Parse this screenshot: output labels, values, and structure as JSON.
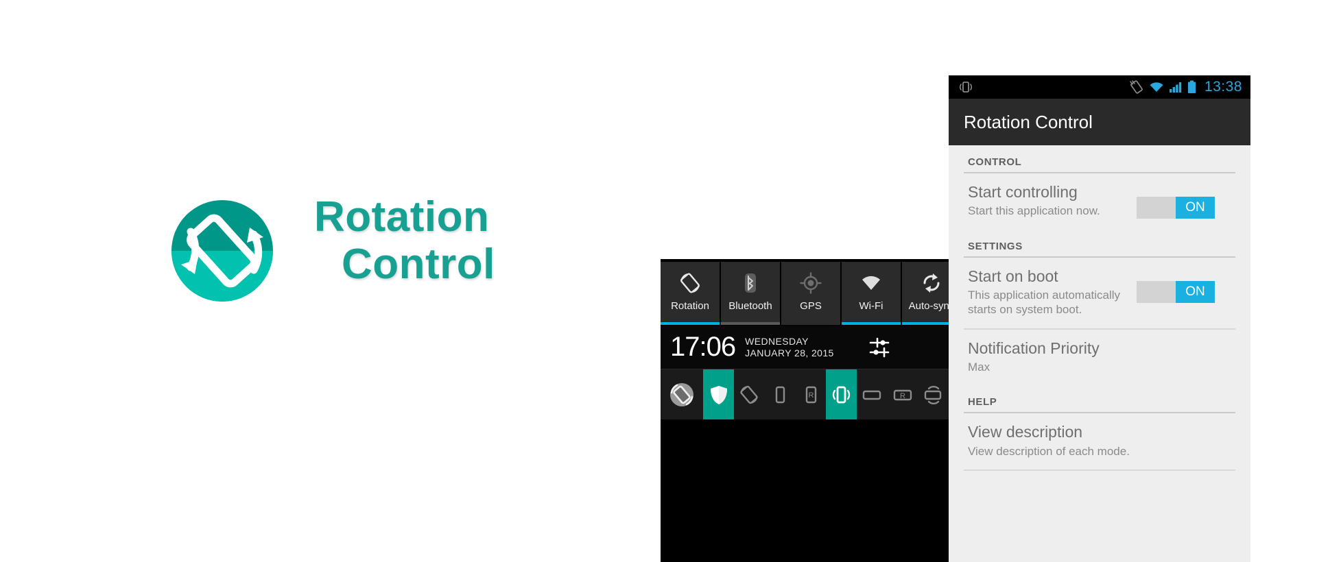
{
  "brand": {
    "logo_icon": "rotation-control-logo-icon",
    "title_line1": "Rotation",
    "title_line2": "Control",
    "accent_dark": "#009688",
    "accent_light": "#00c2ae",
    "text_color": "#18a193"
  },
  "shade": {
    "quick_settings": [
      {
        "label": "Rotation",
        "icon": "auto-rotate-icon",
        "state": "on",
        "underline": "#00b0e0"
      },
      {
        "label": "Bluetooth",
        "icon": "bluetooth-icon",
        "state": "off",
        "underline": "#5a5a5a"
      },
      {
        "label": "GPS",
        "icon": "gps-icon",
        "state": "off",
        "underline": "none"
      },
      {
        "label": "Wi-Fi",
        "icon": "wifi-icon",
        "state": "on",
        "underline": "#00b0e0"
      },
      {
        "label": "Auto-sync",
        "icon": "sync-icon",
        "state": "on",
        "underline": "#00b0e0"
      }
    ],
    "clock": {
      "time": "17:06",
      "day": "WEDNESDAY",
      "date": "JANUARY 28, 2015",
      "settings_icon": "sliders-settings-icon"
    },
    "notification": {
      "app_icon": "rotation-control-app-icon",
      "modes": [
        {
          "icon": "shield-icon",
          "name": "default-mode",
          "active": true
        },
        {
          "icon": "auto-rotate-icon",
          "name": "auto-rotate-mode",
          "active": false
        },
        {
          "icon": "portrait-icon",
          "name": "portrait-mode",
          "active": false
        },
        {
          "icon": "portrait-reverse-icon",
          "name": "reverse-portrait-mode",
          "active": false
        },
        {
          "icon": "sensor-portrait-icon",
          "name": "sensor-portrait-mode",
          "active": true
        },
        {
          "icon": "landscape-icon",
          "name": "landscape-mode",
          "active": false
        },
        {
          "icon": "landscape-reverse-icon",
          "name": "reverse-landscape-mode",
          "active": false
        },
        {
          "icon": "sensor-landscape-icon",
          "name": "sensor-landscape-mode",
          "active": false
        }
      ]
    }
  },
  "phone": {
    "statusbar": {
      "left_icon": "sensor-portrait-status-icon",
      "icons": [
        "rotation-locked-icon",
        "wifi-icon",
        "signal-bars-icon",
        "battery-icon"
      ],
      "time": "13:38",
      "accent": "#2aa7dd"
    },
    "actionbar": {
      "title": "Rotation Control"
    },
    "sections": [
      {
        "header": "CONTROL",
        "items": [
          {
            "title": "Start controlling",
            "summary": "Start this application now.",
            "control": "switch",
            "switch_label": "ON",
            "switch_on": true
          }
        ]
      },
      {
        "header": "SETTINGS",
        "items": [
          {
            "title": "Start on boot",
            "summary": "This application automatically starts on system boot.",
            "control": "switch",
            "switch_label": "ON",
            "switch_on": true
          },
          {
            "title": "Notification Priority",
            "summary": "Max",
            "control": "none"
          }
        ]
      },
      {
        "header": "HELP",
        "items": [
          {
            "title": "View description",
            "summary": "View description of each mode.",
            "control": "none"
          }
        ]
      }
    ]
  }
}
